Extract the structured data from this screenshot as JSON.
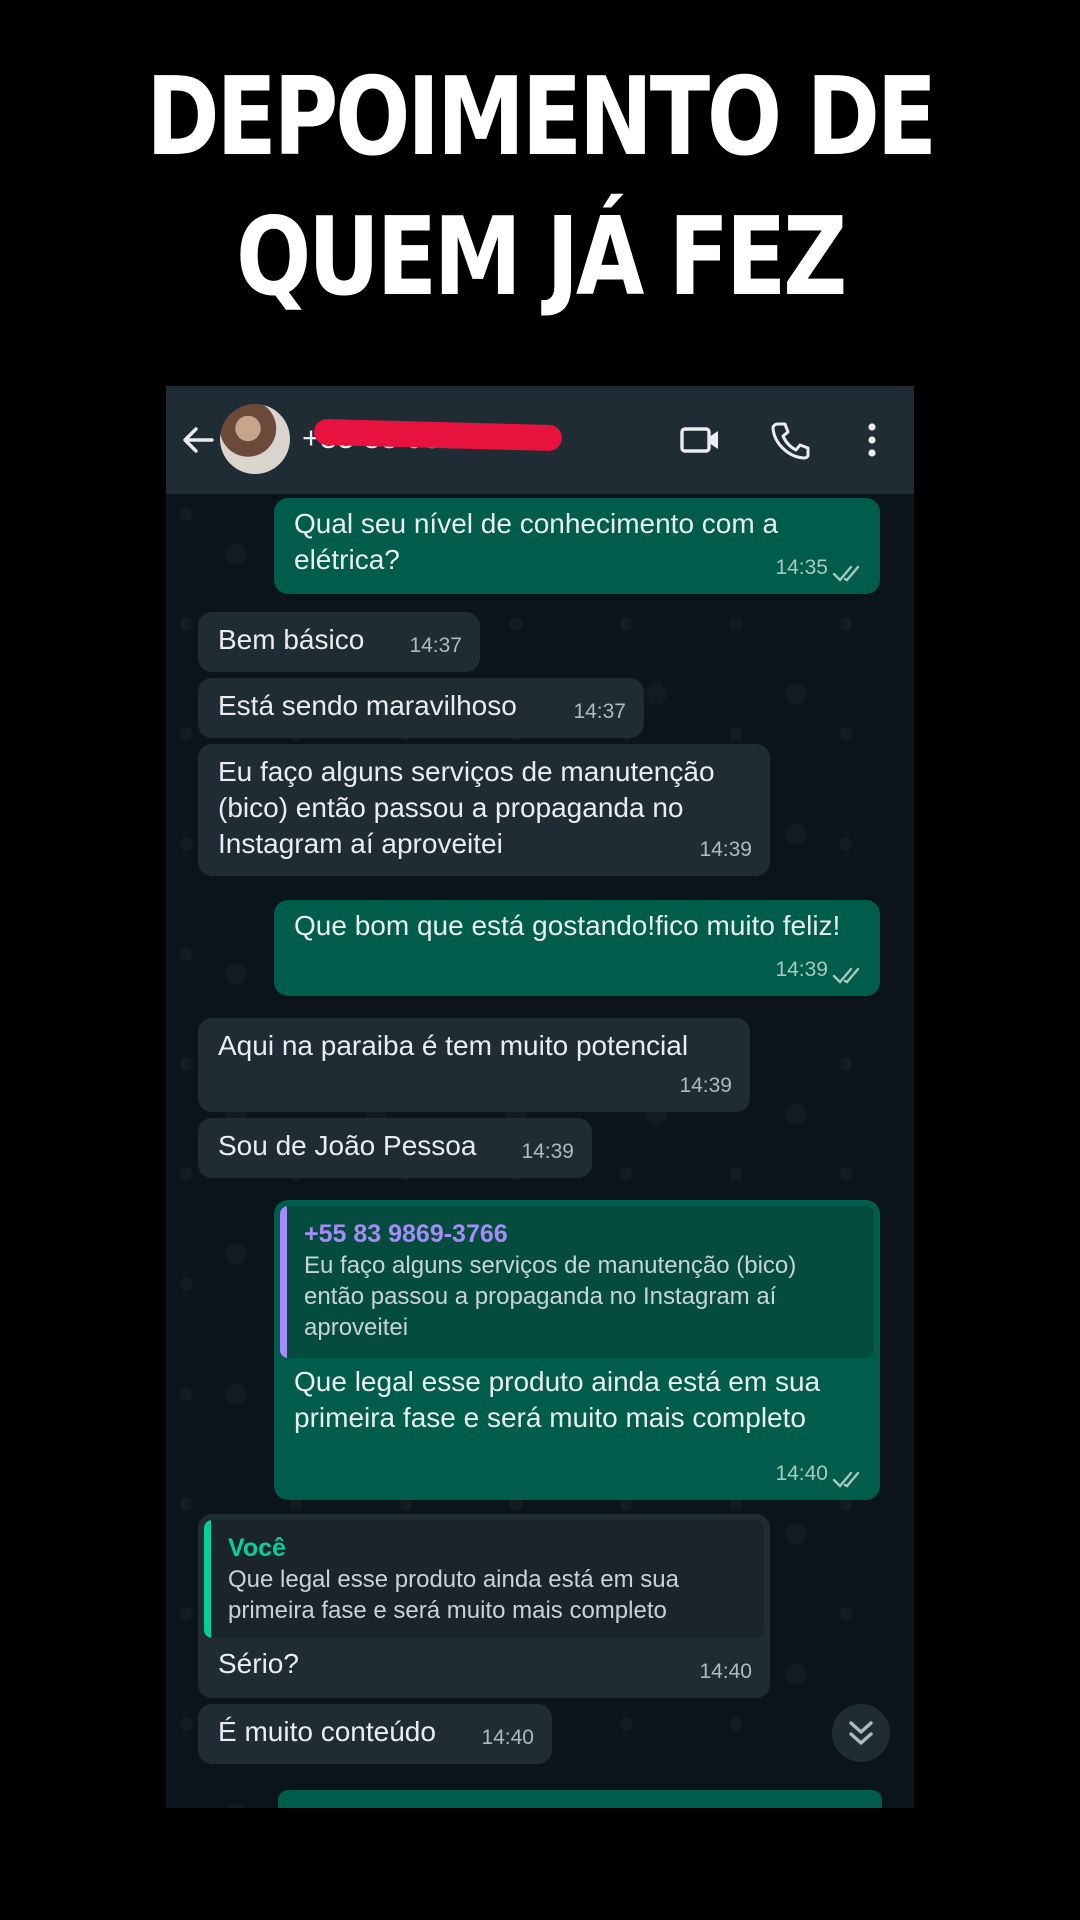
{
  "headline": "DEPOIMENTO DE QUEM JÁ FEZ",
  "header": {
    "contact": "+55 83 9869-3766",
    "icons": [
      "back-arrow-icon",
      "video-call-icon",
      "phone-icon",
      "more-vert-icon"
    ],
    "redaction_color": "#e8123e"
  },
  "colors": {
    "outgoing": "#005c4b",
    "incoming": "#202c33",
    "background": "#0b141a",
    "quote_bar_outgoing": "#a78bfa",
    "quote_bar_incoming": "#06cf9c"
  },
  "messages": [
    {
      "text": "Qual seu nível de conhecimento com a elétrica?",
      "time": "14:35"
    },
    {
      "text": "Bem básico",
      "time": "14:37"
    },
    {
      "text": "Está sendo maravilhoso",
      "time": "14:37"
    },
    {
      "text": "Eu faço alguns serviços de manutenção (bico) então passou a propaganda no Instagram aí aproveitei",
      "time": "14:39"
    },
    {
      "text": "Que bom que está gostando!fico muito feliz!",
      "time": "14:39"
    },
    {
      "text": "Aqui na paraiba é tem muito potencial",
      "time": "14:39"
    },
    {
      "text": "Sou de João Pessoa",
      "time": "14:39"
    },
    {
      "quote_name": "+55 83 9869-3766",
      "quote_text": "Eu faço alguns serviços de manutenção (bico) então passou a propaganda no Instagram aí aproveitei",
      "text": "Que legal esse produto ainda está em sua primeira fase e será muito mais completo",
      "time": "14:40"
    },
    {
      "quote_name": "Você",
      "quote_text": "Que legal esse produto ainda está em sua primeira fase e será muito mais completo",
      "text": "Sério?",
      "time": "14:40"
    },
    {
      "text": "É muito conteúdo",
      "time": "14:40"
    }
  ]
}
